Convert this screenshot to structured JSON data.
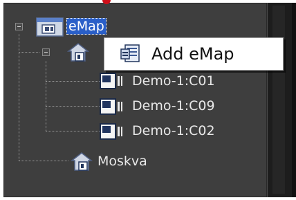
{
  "tree": {
    "root": {
      "label": "eMap",
      "icon": "emap-folder-icon",
      "expanded": true,
      "selected": true
    },
    "group1": {
      "icon": "building-icon",
      "expanded": true
    },
    "cameras": [
      {
        "label": "Demo-1:C01",
        "icon": "camera-icon"
      },
      {
        "label": "Demo-1:C09",
        "icon": "camera-icon"
      },
      {
        "label": "Demo-1:C02",
        "icon": "camera-icon"
      }
    ],
    "group2": {
      "label": "Moskva",
      "icon": "building-icon"
    }
  },
  "context_menu": {
    "items": [
      {
        "label": "Add eMap",
        "icon": "add-emap-icon"
      }
    ]
  },
  "colors": {
    "panel_bg": "#3e3e3e",
    "selection": "#2a5fc8",
    "menu_bg": "#ffffff",
    "marker": "#d0101a"
  }
}
